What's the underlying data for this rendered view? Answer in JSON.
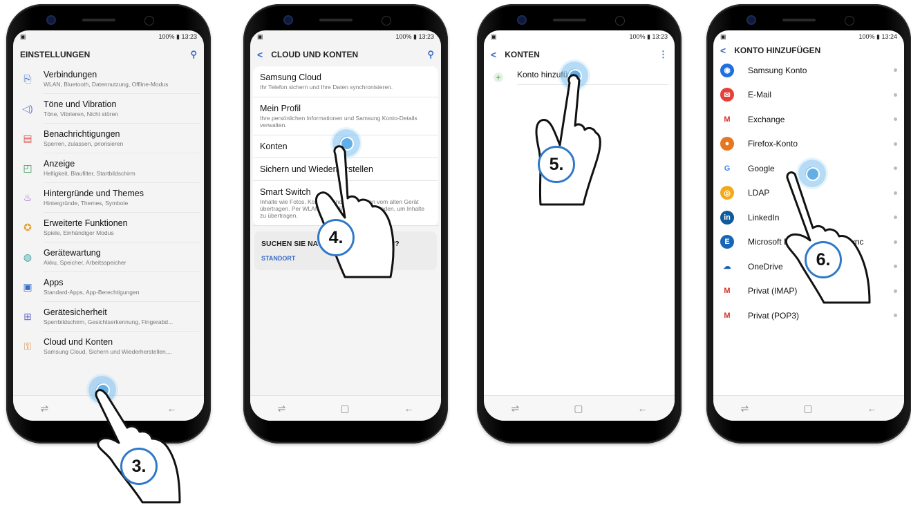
{
  "status": {
    "p1": "100% ▮ 13:23",
    "p2": "100% ▮ 13:23",
    "p3": "100% ▮ 13:23",
    "p4": "100% ▮ 13:24"
  },
  "screen1": {
    "title": "EINSTELLUNGEN",
    "items": [
      {
        "label": "Verbindungen",
        "sub": "WLAN, Bluetooth, Datennutzung, Offline-Modus"
      },
      {
        "label": "Töne und Vibration",
        "sub": "Töne, Vibrieren, Nicht stören"
      },
      {
        "label": "Benachrichtigungen",
        "sub": "Sperren, zulassen, priorisieren"
      },
      {
        "label": "Anzeige",
        "sub": "Helligkeit, Blaufilter, Startbildschirm"
      },
      {
        "label": "Hintergründe und Themes",
        "sub": "Hintergründe, Themes, Symbole"
      },
      {
        "label": "Erweiterte Funktionen",
        "sub": "Spiele, Einhändiger Modus"
      },
      {
        "label": "Gerätewartung",
        "sub": "Akku, Speicher, Arbeitsspeicher"
      },
      {
        "label": "Apps",
        "sub": "Standard-Apps, App-Berechtigungen"
      },
      {
        "label": "Gerätesicherheit",
        "sub": "Sperrbildschirm, Gesichtserkennung, Fingerabd..."
      },
      {
        "label": "Cloud und Konten",
        "sub": "Samsung Cloud, Sichern und Wiederherstellen,..."
      }
    ]
  },
  "screen2": {
    "title": "CLOUD UND KONTEN",
    "items": [
      {
        "label": "Samsung Cloud",
        "sub": "Ihr Telefon sichern und Ihre Daten synchronisieren."
      },
      {
        "label": "Mein Profil",
        "sub": "Ihre persönlichen Informationen und Samsung Konto-Details verwalten."
      },
      {
        "label": "Konten",
        "sub": ""
      },
      {
        "label": "Sichern und Wiederherstellen",
        "sub": ""
      },
      {
        "label": "Smart Switch",
        "sub": "Inhalte wie Fotos, Kontakte und Nachrichten vom alten Gerät übertragen. Per WLAN oder USB-Kabel verwenden, um Inhalte zu übertragen."
      }
    ],
    "suggest_q": "SUCHEN SIE NACH ETWAS ANDEREM?",
    "suggest_link": "STANDORT"
  },
  "screen3": {
    "title": "KONTEN",
    "add": "Konto hinzufügen"
  },
  "screen4": {
    "title": "KONTO HINZUFÜGEN",
    "items": [
      {
        "label": "Samsung Konto",
        "color": "#1f6fe0",
        "glyph": "◉"
      },
      {
        "label": "E-Mail",
        "color": "#e5403a",
        "glyph": "✉"
      },
      {
        "label": "Exchange",
        "color": "#ffffff",
        "glyph": "M"
      },
      {
        "label": "Firefox-Konto",
        "color": "#e8761e",
        "glyph": "●"
      },
      {
        "label": "Google",
        "color": "#ffffff",
        "glyph": "G"
      },
      {
        "label": "LDAP",
        "color": "#f3a91b",
        "glyph": "◎"
      },
      {
        "label": "LinkedIn",
        "color": "#0e5a9c",
        "glyph": "in"
      },
      {
        "label": "Microsoft Exchange ActiveSync",
        "color": "#1866b7",
        "glyph": "E"
      },
      {
        "label": "OneDrive",
        "color": "#ffffff",
        "glyph": "☁"
      },
      {
        "label": "Privat (IMAP)",
        "color": "#ffffff",
        "glyph": "M"
      },
      {
        "label": "Privat (POP3)",
        "color": "#ffffff",
        "glyph": "M"
      }
    ]
  },
  "steps": {
    "s3": "3.",
    "s4": "4.",
    "s5": "5.",
    "s6": "6."
  }
}
